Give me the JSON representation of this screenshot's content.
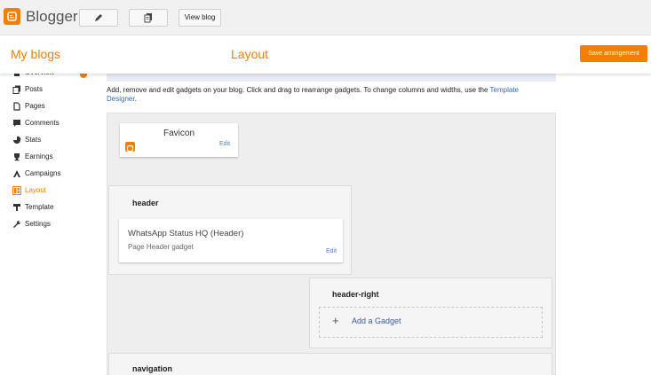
{
  "app": {
    "brand": "Blogger",
    "view_blog_label": "View blog"
  },
  "header": {
    "my_blogs": "My blogs",
    "page_title": "Layout",
    "save_label": "Save arrangement"
  },
  "sidebar": {
    "items": [
      {
        "label": "Overview",
        "icon": "home-icon"
      },
      {
        "label": "Posts",
        "icon": "posts-icon"
      },
      {
        "label": "Pages",
        "icon": "pages-icon"
      },
      {
        "label": "Comments",
        "icon": "comments-icon"
      },
      {
        "label": "Stats",
        "icon": "stats-icon"
      },
      {
        "label": "Earnings",
        "icon": "trophy-icon"
      },
      {
        "label": "Campaigns",
        "icon": "campaigns-icon"
      },
      {
        "label": "Layout",
        "icon": "layout-icon",
        "active": true
      },
      {
        "label": "Template",
        "icon": "template-icon"
      },
      {
        "label": "Settings",
        "icon": "wrench-icon"
      }
    ]
  },
  "main": {
    "intro_text": "Add, remove and edit gadgets on your blog. Click and drag to rearrange gadgets. To change columns and widths, use the ",
    "intro_link": "Template Designer",
    "intro_end": ".",
    "favicon": {
      "title": "Favicon",
      "edit": "Edit"
    },
    "header_section": {
      "title": "header",
      "gadget_title": "WhatsApp Status HQ (Header)",
      "gadget_sub": "Page Header gadget",
      "edit": "Edit"
    },
    "header_right_section": {
      "title": "header-right",
      "add_gadget": "Add a Gadget",
      "plus": "+"
    },
    "navigation_section": {
      "title": "navigation"
    }
  },
  "colors": {
    "accent": "#f57d00",
    "link": "#3366cc",
    "panel_bg": "#eeeeee"
  }
}
